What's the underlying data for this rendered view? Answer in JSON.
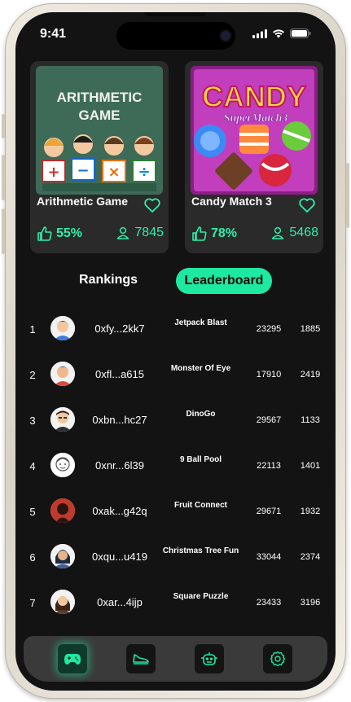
{
  "status": {
    "time": "9:41"
  },
  "cards": [
    {
      "title": "Arithmetic Game",
      "thumb_title_line1": "ARITHMETIC",
      "thumb_title_line2": "GAME",
      "symbols": [
        "+",
        "−",
        "×",
        "÷"
      ],
      "like_percent": "55%",
      "players": "7845"
    },
    {
      "title": "Candy Match 3",
      "thumb_title": "CANDY",
      "thumb_subtitle": "SuperMatch3",
      "like_percent": "78%",
      "players": "5468"
    }
  ],
  "tabs": {
    "rankings": "Rankings",
    "leaderboard": "Leaderboard"
  },
  "rows": [
    {
      "rank": "1",
      "address": "0xfy...2kk7",
      "game": "Jetpack Blast",
      "score": "23295",
      "count": "1885"
    },
    {
      "rank": "2",
      "address": "0xfl...a615",
      "game": "Monster Of Eye",
      "score": "17910",
      "count": "2419"
    },
    {
      "rank": "3",
      "address": "0xbn...hc27",
      "game": "DinoGo",
      "score": "29567",
      "count": "1133"
    },
    {
      "rank": "4",
      "address": "0xnr...6l39",
      "game": "9 Ball Pool",
      "score": "22113",
      "count": "1401"
    },
    {
      "rank": "5",
      "address": "0xak...g42q",
      "game": "Fruit Connect",
      "score": "29671",
      "count": "1932"
    },
    {
      "rank": "6",
      "address": "0xqu...u419",
      "game": "Christmas Tree Fun",
      "score": "33044",
      "count": "2374"
    },
    {
      "rank": "7",
      "address": "0xar...4ijp",
      "game": "Square Puzzle",
      "score": "23433",
      "count": "3196"
    }
  ],
  "nav": [
    "gamepad-icon",
    "sneaker-icon",
    "robot-icon",
    "gear-icon"
  ],
  "colors": {
    "accent": "#1de9a0",
    "background": "#131313",
    "card": "#2a2a2a"
  }
}
